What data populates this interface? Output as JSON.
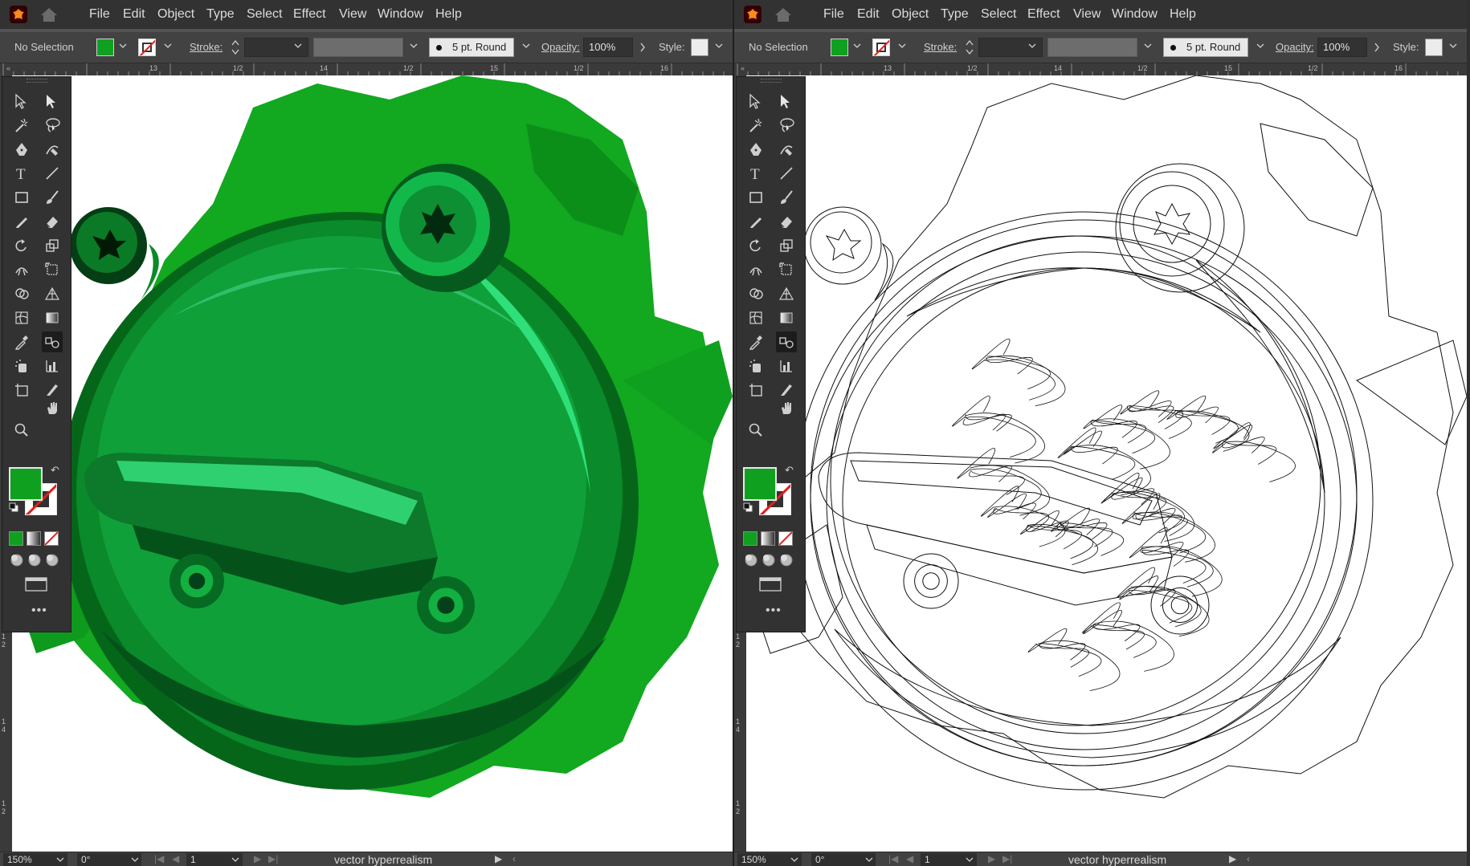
{
  "menu": [
    "File",
    "Edit",
    "Object",
    "Type",
    "Select",
    "Effect",
    "View",
    "Window",
    "Help"
  ],
  "control": {
    "selection_label": "No Selection",
    "stroke_label": "Stroke:",
    "brush_label": "5 pt. Round",
    "opacity_label": "Opacity:",
    "opacity_value": "100%",
    "style_label": "Style:"
  },
  "ruler_top_labels": [
    "13",
    "1/2",
    "14",
    "1/2",
    "15",
    "1/2",
    "16"
  ],
  "ruler_left_labels": [
    "1",
    "2",
    "1",
    "4",
    "1",
    "2"
  ],
  "status": {
    "zoom": "150%",
    "rotation": "0°",
    "artboard": "1",
    "doc_name": "vector hyperrealism"
  },
  "colors": {
    "fill": "#10a020",
    "ui_dark": "#323232",
    "ui_panel": "#424242",
    "canvas": "#ffffff"
  },
  "icons": [
    "app-logo-icon",
    "home-icon",
    "selection-tool-icon",
    "direct-selection-tool-icon",
    "magic-wand-icon",
    "lasso-icon",
    "pen-icon",
    "curvature-icon",
    "type-icon",
    "line-icon",
    "rectangle-icon",
    "paintbrush-icon",
    "pencil-icon",
    "eraser-icon",
    "rotate-icon",
    "scale-icon",
    "width-icon",
    "free-transform-icon",
    "shape-builder-icon",
    "perspective-grid-icon",
    "mesh-icon",
    "gradient-icon",
    "eyedropper-icon",
    "blend-icon",
    "symbol-sprayer-icon",
    "column-graph-icon",
    "artboard-icon",
    "slice-icon",
    "hand-icon",
    "zoom-icon"
  ],
  "views": [
    "preview",
    "outline"
  ]
}
